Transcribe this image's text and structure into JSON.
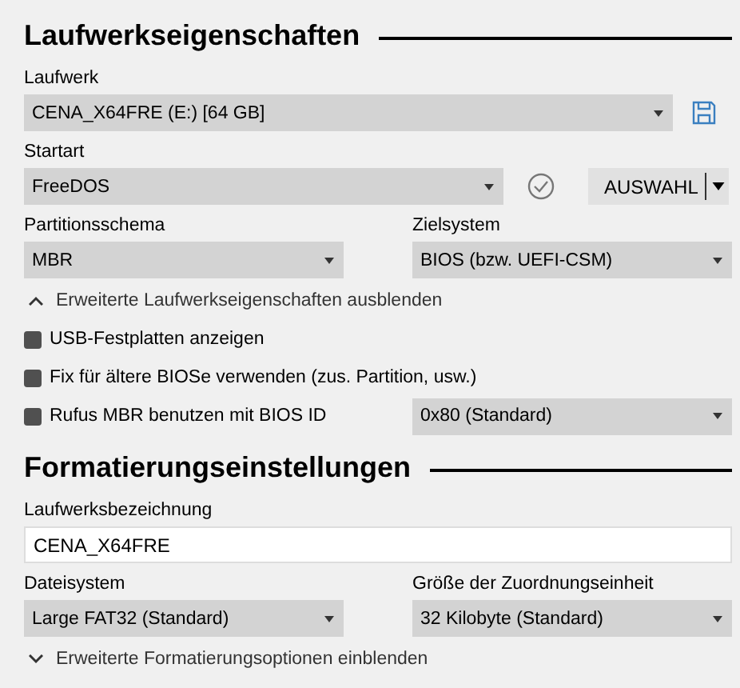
{
  "drive_properties": {
    "title": "Laufwerkseigenschaften",
    "drive": {
      "label": "Laufwerk",
      "value": "CENA_X64FRE (E:) [64 GB]"
    },
    "boot": {
      "label": "Startart",
      "value": "FreeDOS",
      "button": "AUSWAHL"
    },
    "partition": {
      "label": "Partitionsschema",
      "value": "MBR"
    },
    "target": {
      "label": "Zielsystem",
      "value": "BIOS (bzw. UEFI-CSM)"
    },
    "toggle": {
      "label": "Erweiterte Laufwerkseigenschaften ausblenden",
      "expanded": true
    },
    "options": [
      {
        "label": "USB-Festplatten anzeigen",
        "checked": false
      },
      {
        "label": "Fix für ältere BIOSe verwenden (zus. Partition, usw.)",
        "checked": false
      },
      {
        "label": "Rufus MBR benutzen mit BIOS ID",
        "checked": false,
        "dropdown": "0x80 (Standard)"
      }
    ]
  },
  "format_options": {
    "title": "Formatierungseinstellungen",
    "volume_label": {
      "label": "Laufwerksbezeichnung",
      "value": "CENA_X64FRE"
    },
    "filesystem": {
      "label": "Dateisystem",
      "value": "Large FAT32 (Standard)"
    },
    "cluster_size": {
      "label": "Größe der Zuordnungseinheit",
      "value": "32 Kilobyte (Standard)"
    },
    "toggle": {
      "label": "Erweiterte Formatierungsoptionen einblenden",
      "expanded": false
    }
  }
}
